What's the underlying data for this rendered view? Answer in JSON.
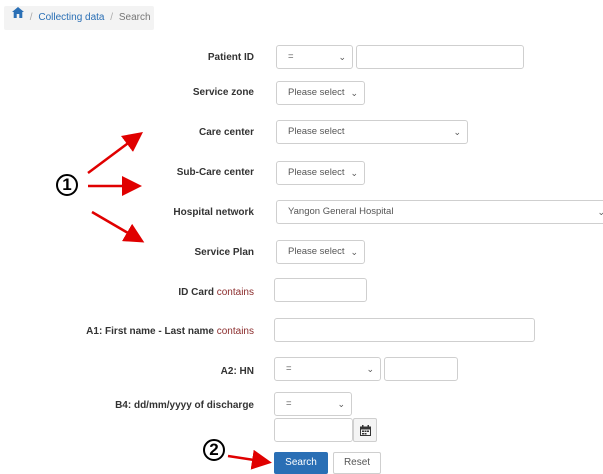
{
  "breadcrumb": {
    "link": "Collecting data",
    "separator": "/",
    "current": "Search"
  },
  "form": {
    "patient_id": {
      "label": "Patient ID",
      "operator": "=",
      "value": ""
    },
    "service_zone": {
      "label": "Service zone",
      "value": "Please select"
    },
    "care_center": {
      "label": "Care center",
      "value": "Please select"
    },
    "sub_care_center": {
      "label": "Sub-Care center",
      "value": "Please select"
    },
    "hospital_network": {
      "label": "Hospital network",
      "value": "Yangon General Hospital"
    },
    "service_plan": {
      "label": "Service Plan",
      "value": "Please select"
    },
    "id_card": {
      "label": "ID Card",
      "qualifier": "contains",
      "value": ""
    },
    "name": {
      "label": "A1: First name - Last name",
      "qualifier": "contains",
      "value": ""
    },
    "hn": {
      "label": "A2: HN",
      "operator": "=",
      "value": ""
    },
    "discharge": {
      "label": "B4: dd/mm/yyyy of discharge",
      "operator": "=",
      "value": ""
    }
  },
  "buttons": {
    "search": "Search",
    "reset": "Reset"
  },
  "annotations": {
    "marker1": "1",
    "marker2": "2",
    "color": "#e00000"
  },
  "icons": {
    "home": "home-icon",
    "chevron": "chevron-down-icon",
    "calendar": "calendar-icon"
  }
}
